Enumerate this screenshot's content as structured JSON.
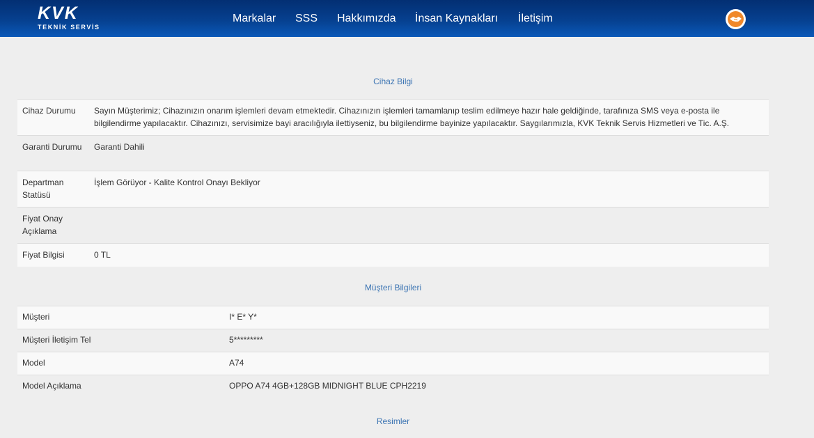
{
  "header": {
    "logo_main": "KVK",
    "logo_sub": "TEKNİK SERVİS",
    "nav": [
      "Markalar",
      "SSS",
      "Hakkımızda",
      "İnsan Kaynakları",
      "İletişim"
    ]
  },
  "device_section": {
    "title": "Cihaz Bilgi",
    "rows": [
      {
        "label": "Cihaz Durumu",
        "value": "Sayın Müşterimiz; Cihazınızın onarım işlemleri devam etmektedir. Cihazınızın işlemleri tamamlanıp teslim edilmeye hazır hale geldiğinde, tarafınıza SMS veya e-posta ile bilgilendirme yapılacaktır. Cihazınızı, servisimize bayi aracılığıyla ilettiyseniz, bu bilgilendirme bayinize yapılacaktır. Saygılarımızla, KVK Teknik Servis Hizmetleri ve Tic. A.Ş."
      },
      {
        "label": "Garanti Durumu",
        "value": "Garanti Dahili"
      },
      {
        "label": "Departman Statüsü",
        "value": "İşlem Görüyor - Kalite Kontrol Onayı Bekliyor"
      },
      {
        "label": "Fiyat Onay Açıklama",
        "value": ""
      },
      {
        "label": "Fiyat Bilgisi",
        "value": "0 TL"
      }
    ]
  },
  "customer_section": {
    "title": "Müşteri Bilgileri",
    "rows": [
      {
        "label": "Müşteri",
        "value": "I* E* Y*"
      },
      {
        "label": "Müşteri İletişim Tel",
        "value": "5*********"
      },
      {
        "label": "Model",
        "value": "A74"
      },
      {
        "label": "Model Açıklama",
        "value": "OPPO A74 4GB+128GB MIDNIGHT BLUE CPH2219"
      }
    ]
  },
  "images_section": {
    "title": "Resimler"
  },
  "colors": {
    "header": "#06408f",
    "accent_link": "#3d75b3",
    "status_orange": "#e4601a",
    "profile_orange": "#f0882a"
  },
  "icons": {
    "profile": "handshake-icon"
  }
}
